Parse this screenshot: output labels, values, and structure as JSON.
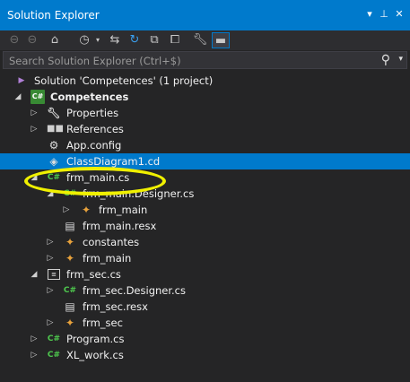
{
  "window": {
    "title": "Solution Explorer",
    "buttons": [
      "▾",
      "⊥",
      "✕"
    ]
  },
  "toolbar": {
    "icons": [
      "back-icon",
      "forward-icon",
      "home-icon",
      "history-icon",
      "sync-icon",
      "refresh-icon",
      "collapse-all-icon",
      "show-all-files-icon",
      "properties-icon",
      "preview-icon"
    ]
  },
  "search": {
    "placeholder": "Search Solution Explorer (Ctrl+$)"
  },
  "tree": {
    "items": [
      {
        "label": "Solution 'Competences' (1 project)",
        "icon": "solution-icon",
        "expander": "",
        "bold": false,
        "selected": false
      },
      {
        "label": "Competences",
        "icon": "csharp-project-icon",
        "expander": "◢",
        "bold": true,
        "selected": false
      },
      {
        "label": "Properties",
        "icon": "wrench-icon",
        "expander": "▷",
        "bold": false,
        "selected": false
      },
      {
        "label": "References",
        "icon": "references-icon",
        "expander": "▷",
        "bold": false,
        "selected": false
      },
      {
        "label": "App.config",
        "icon": "config-file-icon",
        "expander": "",
        "bold": false,
        "selected": false
      },
      {
        "label": "ClassDiagram1.cd",
        "icon": "class-diagram-icon",
        "expander": "",
        "bold": false,
        "selected": true
      },
      {
        "label": "frm_main.cs",
        "icon": "csharp-file-icon",
        "expander": "◢",
        "bold": false,
        "selected": false
      },
      {
        "label": "frm_main.Designer.cs",
        "icon": "csharp-file-icon",
        "expander": "◢",
        "bold": false,
        "selected": false
      },
      {
        "label": "frm_main",
        "icon": "class-icon",
        "expander": "▷",
        "bold": false,
        "selected": false
      },
      {
        "label": "frm_main.resx",
        "icon": "resource-file-icon",
        "expander": "",
        "bold": false,
        "selected": false
      },
      {
        "label": "constantes",
        "icon": "class-icon",
        "expander": "▷",
        "bold": false,
        "selected": false
      },
      {
        "label": "frm_main",
        "icon": "class-icon",
        "expander": "▷",
        "bold": false,
        "selected": false
      },
      {
        "label": "frm_sec.cs",
        "icon": "form-icon",
        "expander": "◢",
        "bold": false,
        "selected": false
      },
      {
        "label": "frm_sec.Designer.cs",
        "icon": "csharp-file-icon",
        "expander": "▷",
        "bold": false,
        "selected": false
      },
      {
        "label": "frm_sec.resx",
        "icon": "resource-file-icon",
        "expander": "",
        "bold": false,
        "selected": false
      },
      {
        "label": "frm_sec",
        "icon": "class-icon",
        "expander": "▷",
        "bold": false,
        "selected": false
      },
      {
        "label": "Program.cs",
        "icon": "csharp-file-icon",
        "expander": "▷",
        "bold": false,
        "selected": false
      },
      {
        "label": "XL_work.cs",
        "icon": "csharp-file-icon",
        "expander": "▷",
        "bold": false,
        "selected": false
      }
    ]
  },
  "colors": {
    "titlebar": "#007acc",
    "background": "#252526",
    "selection": "#007acc",
    "annotation": "#f0f000"
  }
}
